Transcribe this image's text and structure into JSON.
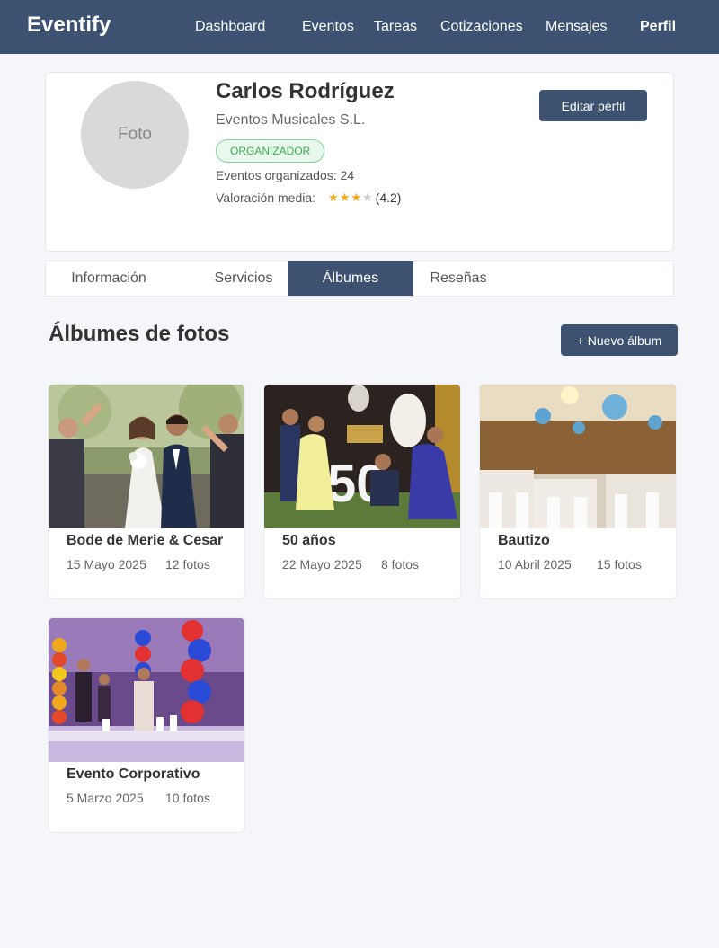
{
  "nav": {
    "brand": "Eventify",
    "links": [
      "Dashboard",
      "Eventos",
      "Tareas",
      "Cotizaciones",
      "Mensajes",
      "Perfil"
    ]
  },
  "profile": {
    "avatar_label": "Foto",
    "name": "Carlos Rodríguez",
    "company": "Eventos Musicales S.L.",
    "role": "ORGANIZADOR",
    "events_label": "Eventos organizados: 24",
    "rating_label": "Valoración media:",
    "rating_value": 4.2,
    "rating_text": "(4.2)",
    "stars_filled": 3,
    "stars_total": 4,
    "edit_label": "Editar perfil"
  },
  "tabs": [
    "Información",
    "Servicios",
    "Álbumes",
    "Reseñas"
  ],
  "active_tab": "Álbumes",
  "section": {
    "title": "Álbumes de fotos",
    "new_album_label": "+ Nuevo álbum"
  },
  "albums": [
    {
      "title": "Bode de Merie & Cesar",
      "date": "15 Mayo 2025",
      "count": "12 fotos"
    },
    {
      "title": "50 años",
      "date": "22 Mayo 2025",
      "count": "8 fotos"
    },
    {
      "title": "Bautizo",
      "date": "10 Abril 2025",
      "count": "15 fotos"
    },
    {
      "title": "Evento Corporativo",
      "date": "5 Marzo 2025",
      "count": "10 fotos"
    }
  ],
  "colors": {
    "primary": "#3c5270",
    "badge_green": "#3fa85a",
    "star": "#f2a81e",
    "background": "#f5f6fa"
  }
}
